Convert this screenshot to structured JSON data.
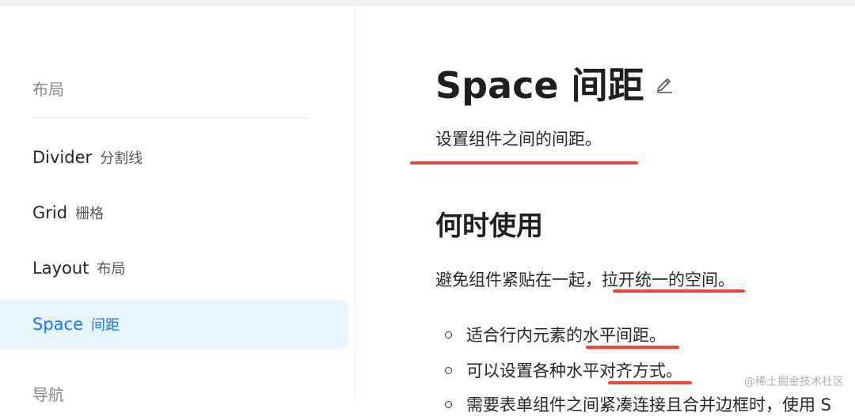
{
  "sidebar": {
    "group_layout": "布局",
    "group_nav": "导航",
    "items": [
      {
        "en": "Divider",
        "zh": "分割线"
      },
      {
        "en": "Grid",
        "zh": "栅格"
      },
      {
        "en": "Layout",
        "zh": "布局"
      },
      {
        "en": "Space",
        "zh": "间距"
      }
    ]
  },
  "main": {
    "title": "Space 间距",
    "description": "设置组件之间的间距。",
    "section_title": "何时使用",
    "paragraph": "避免组件紧贴在一起，拉开统一的空间。",
    "bullets": [
      "适合行内元素的水平间距。",
      "可以设置各种水平对齐方式。",
      "需要表单组件之间紧凑连接且合并边框时，使用 S"
    ]
  },
  "watermark": "@稀土掘金技术社区",
  "colors": {
    "accent": "#1677ff",
    "active_bg": "#e6f4ff",
    "annotation": "#ef4444"
  }
}
